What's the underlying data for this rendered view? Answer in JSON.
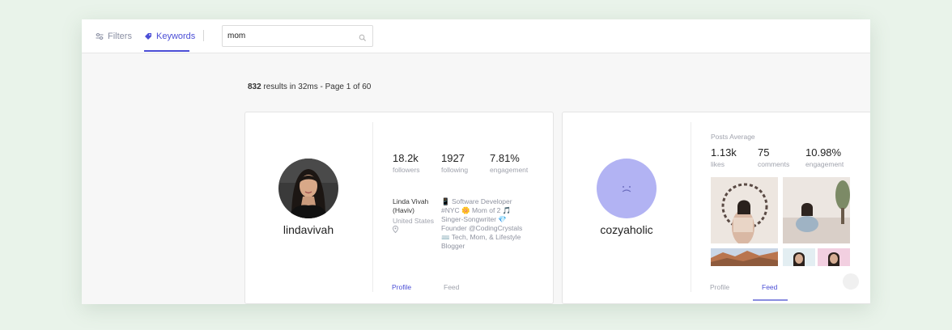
{
  "topbar": {
    "tabs": [
      {
        "label": "Filters",
        "icon": "sliders-icon"
      },
      {
        "label": "Keywords",
        "icon": "tag-icon"
      }
    ],
    "search_value": "mom"
  },
  "results": {
    "count": "832",
    "rest": " results in 32ms - Page 1 of 60"
  },
  "cards": [
    {
      "username": "lindavivah",
      "stats": [
        {
          "value": "18.2k",
          "label": "followers"
        },
        {
          "value": "1927",
          "label": "following"
        },
        {
          "value": "7.81%",
          "label": "engagement"
        }
      ],
      "bio_name": "Linda Vivah (Haviv)",
      "bio_location": "United States",
      "bio_lines": [
        "📱 Software Developer",
        "#NYC 🌼 Mom of 2 🎵",
        "Singer-Songwriter 💎",
        "Founder @CodingCrystals",
        "⌨️ Tech, Mom, & Lifestyle",
        "Blogger"
      ],
      "tabs": [
        "Profile",
        "Feed"
      ]
    },
    {
      "username": "cozyaholic",
      "posts_average_label": "Posts Average",
      "stats": [
        {
          "value": "1.13k",
          "label": "likes"
        },
        {
          "value": "75",
          "label": "comments"
        },
        {
          "value": "10.98%",
          "label": "engagement"
        }
      ],
      "tabs": [
        "Profile",
        "Feed"
      ]
    }
  ],
  "colors": {
    "accent": "#4b4ed6",
    "avatar_placeholder": "#b2b3f3",
    "background": "#e9f3ea"
  }
}
